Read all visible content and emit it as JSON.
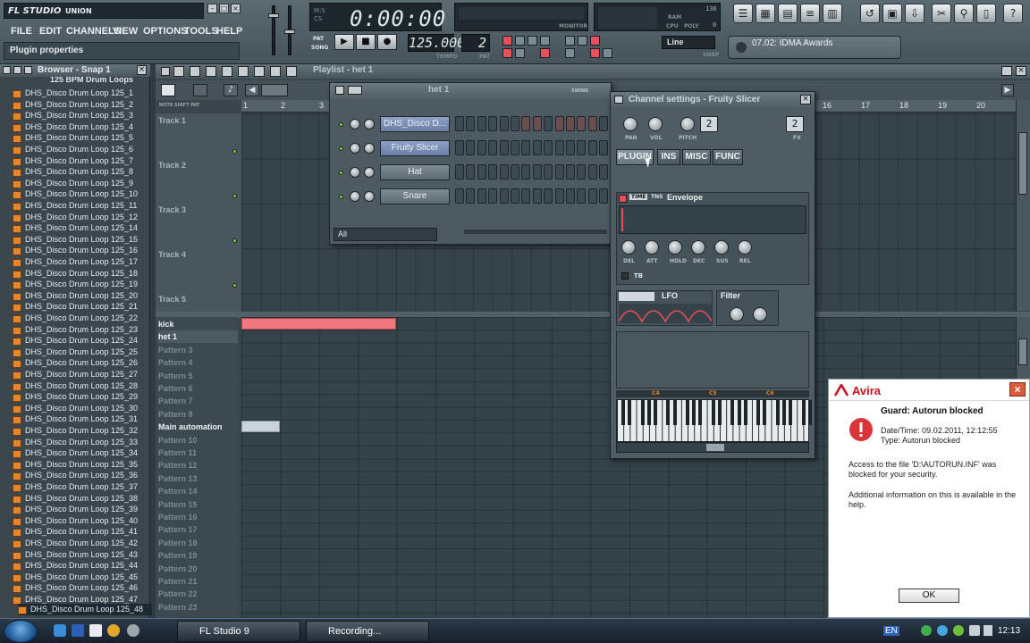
{
  "app": {
    "logo": "FL STUDIO",
    "user": "UNION"
  },
  "menu": [
    "FILE",
    "EDIT",
    "CHANNELS",
    "VIEW",
    "OPTIONS",
    "TOOLS",
    "HELP"
  ],
  "hint_bar": "Plugin properties",
  "time_display": "0:00:00",
  "time_side": [
    "M:S",
    "CS"
  ],
  "transport": {
    "pat_label": "PAT",
    "song_label": "SONG",
    "tempo": "125.000",
    "tempo_label": "TEMPO",
    "pattern": "2",
    "pattern_label": "PAT"
  },
  "monitor_label": "MONITOR",
  "cpu": {
    "ram": "136",
    "cpu_label": "CPU",
    "poly": "0",
    "poly_label": "POLY",
    "ram_label": "RAM"
  },
  "snap": {
    "value": "Line",
    "label": "SNAP"
  },
  "song": {
    "title": "07.02: IDMA Awards"
  },
  "browser": {
    "title": "Browser - Snap 1",
    "folder": "125 BPM Drum Loops",
    "files": [
      "DHS_Disco Drum Loop 125_1",
      "DHS_Disco Drum Loop 125_2",
      "DHS_Disco Drum Loop 125_3",
      "DHS_Disco Drum Loop 125_4",
      "DHS_Disco Drum Loop 125_5",
      "DHS_Disco Drum Loop 125_6",
      "DHS_Disco Drum Loop 125_7",
      "DHS_Disco Drum Loop 125_8",
      "DHS_Disco Drum Loop 125_9",
      "DHS_Disco Drum Loop 125_10",
      "DHS_Disco Drum Loop 125_11",
      "DHS_Disco Drum Loop 125_12",
      "DHS_Disco Drum Loop 125_14",
      "DHS_Disco Drum Loop 125_15",
      "DHS_Disco Drum Loop 125_16",
      "DHS_Disco Drum Loop 125_17",
      "DHS_Disco Drum Loop 125_18",
      "DHS_Disco Drum Loop 125_19",
      "DHS_Disco Drum Loop 125_20",
      "DHS_Disco Drum Loop 125_21",
      "DHS_Disco Drum Loop 125_22",
      "DHS_Disco Drum Loop 125_23",
      "DHS_Disco Drum Loop 125_24",
      "DHS_Disco Drum Loop 125_25",
      "DHS_Disco Drum Loop 125_26",
      "DHS_Disco Drum Loop 125_27",
      "DHS_Disco Drum Loop 125_28",
      "DHS_Disco Drum Loop 125_29",
      "DHS_Disco Drum Loop 125_30",
      "DHS_Disco Drum Loop 125_31",
      "DHS_Disco Drum Loop 125_32",
      "DHS_Disco Drum Loop 125_33",
      "DHS_Disco Drum Loop 125_34",
      "DHS_Disco Drum Loop 125_35",
      "DHS_Disco Drum Loop 125_36",
      "DHS_Disco Drum Loop 125_37",
      "DHS_Disco Drum Loop 125_38",
      "DHS_Disco Drum Loop 125_39",
      "DHS_Disco Drum Loop 125_40",
      "DHS_Disco Drum Loop 125_41",
      "DHS_Disco Drum Loop 125_42",
      "DHS_Disco Drum Loop 125_43",
      "DHS_Disco Drum Loop 125_44",
      "DHS_Disco Drum Loop 125_45",
      "DHS_Disco Drum Loop 125_46",
      "DHS_Disco Drum Loop 125_47"
    ],
    "selected_file": "DHS_Disco Drum Loop 125_48"
  },
  "playlist": {
    "title": "Playlist - het 1",
    "ruler_labels": [
      "NOTE",
      "SHIFT",
      "PAT"
    ],
    "ruler": [
      "1",
      "2",
      "3",
      "16",
      "17",
      "18",
      "19",
      "20"
    ],
    "tracks": [
      "Track 1",
      "Track 2",
      "Track 3",
      "Track 4",
      "Track 5"
    ],
    "patterns": [
      {
        "name": "kick",
        "active": true
      },
      {
        "name": "het 1",
        "active": true
      },
      {
        "name": "Pattern 3",
        "active": false
      },
      {
        "name": "Pattern 4",
        "active": false
      },
      {
        "name": "Pattern 5",
        "active": false
      },
      {
        "name": "Pattern 6",
        "active": false
      },
      {
        "name": "Pattern 7",
        "active": false
      },
      {
        "name": "Pattern 8",
        "active": false
      },
      {
        "name": "Main automation",
        "active": true
      },
      {
        "name": "Pattern 10",
        "active": false
      },
      {
        "name": "Pattern 11",
        "active": false
      },
      {
        "name": "Pattern 12",
        "active": false
      },
      {
        "name": "Pattern 13",
        "active": false
      },
      {
        "name": "Pattern 14",
        "active": false
      },
      {
        "name": "Pattern 15",
        "active": false
      },
      {
        "name": "Pattern 16",
        "active": false
      },
      {
        "name": "Pattern 17",
        "active": false
      },
      {
        "name": "Pattern 18",
        "active": false
      },
      {
        "name": "Pattern 19",
        "active": false
      },
      {
        "name": "Pattern 20",
        "active": false
      },
      {
        "name": "Pattern 21",
        "active": false
      },
      {
        "name": "Pattern 22",
        "active": false
      },
      {
        "name": "Pattern 23",
        "active": false
      }
    ]
  },
  "stepseq": {
    "pattern": "het 1",
    "swing_label": "SWING",
    "channels": [
      "DHS_Disco D...",
      "Fruity Slicer",
      "Hat",
      "Snare"
    ],
    "filter": "All"
  },
  "channel_settings": {
    "title": "Channel settings - Fruity Slicer",
    "knob_labels": [
      "PAN",
      "VOL",
      "PITCH"
    ],
    "pitch_range": "2",
    "fx": "2",
    "fx_label": "FX",
    "tabs": [
      "PLUGIN",
      "INS",
      "MISC",
      "FUNC"
    ],
    "env_tabs": [
      "TIME",
      "TNS"
    ],
    "env_title": "Envelope",
    "env_knobs": [
      "DEL",
      "ATT",
      "HOLD",
      "DEC",
      "SUS",
      "REL"
    ],
    "tb_label": "TB",
    "lfo_title": "LFO",
    "filter_title": "Filter",
    "piano_labels": [
      "C4",
      "C5",
      "C6"
    ]
  },
  "avira": {
    "brand": "Avira",
    "title": "Guard: Autorun blocked",
    "datetime": "Date/Time: 09.02.2011, 12:12:55",
    "type": "Type: Autorun blocked",
    "message": "Access to the file 'D:\\AUTORUN.INF' was blocked for your security.",
    "additional": "Additional information on this is available in the help.",
    "ok": "OK"
  },
  "taskbar": {
    "tasks": [
      "FL Studio 9",
      "Recording..."
    ],
    "lang": "EN",
    "clock": "12:13"
  },
  "colors": {
    "accent_red": "#e94f5b",
    "pattern_block": "#f07880",
    "auto_block": "#c9d3dc",
    "avira_red": "#c8101e"
  }
}
